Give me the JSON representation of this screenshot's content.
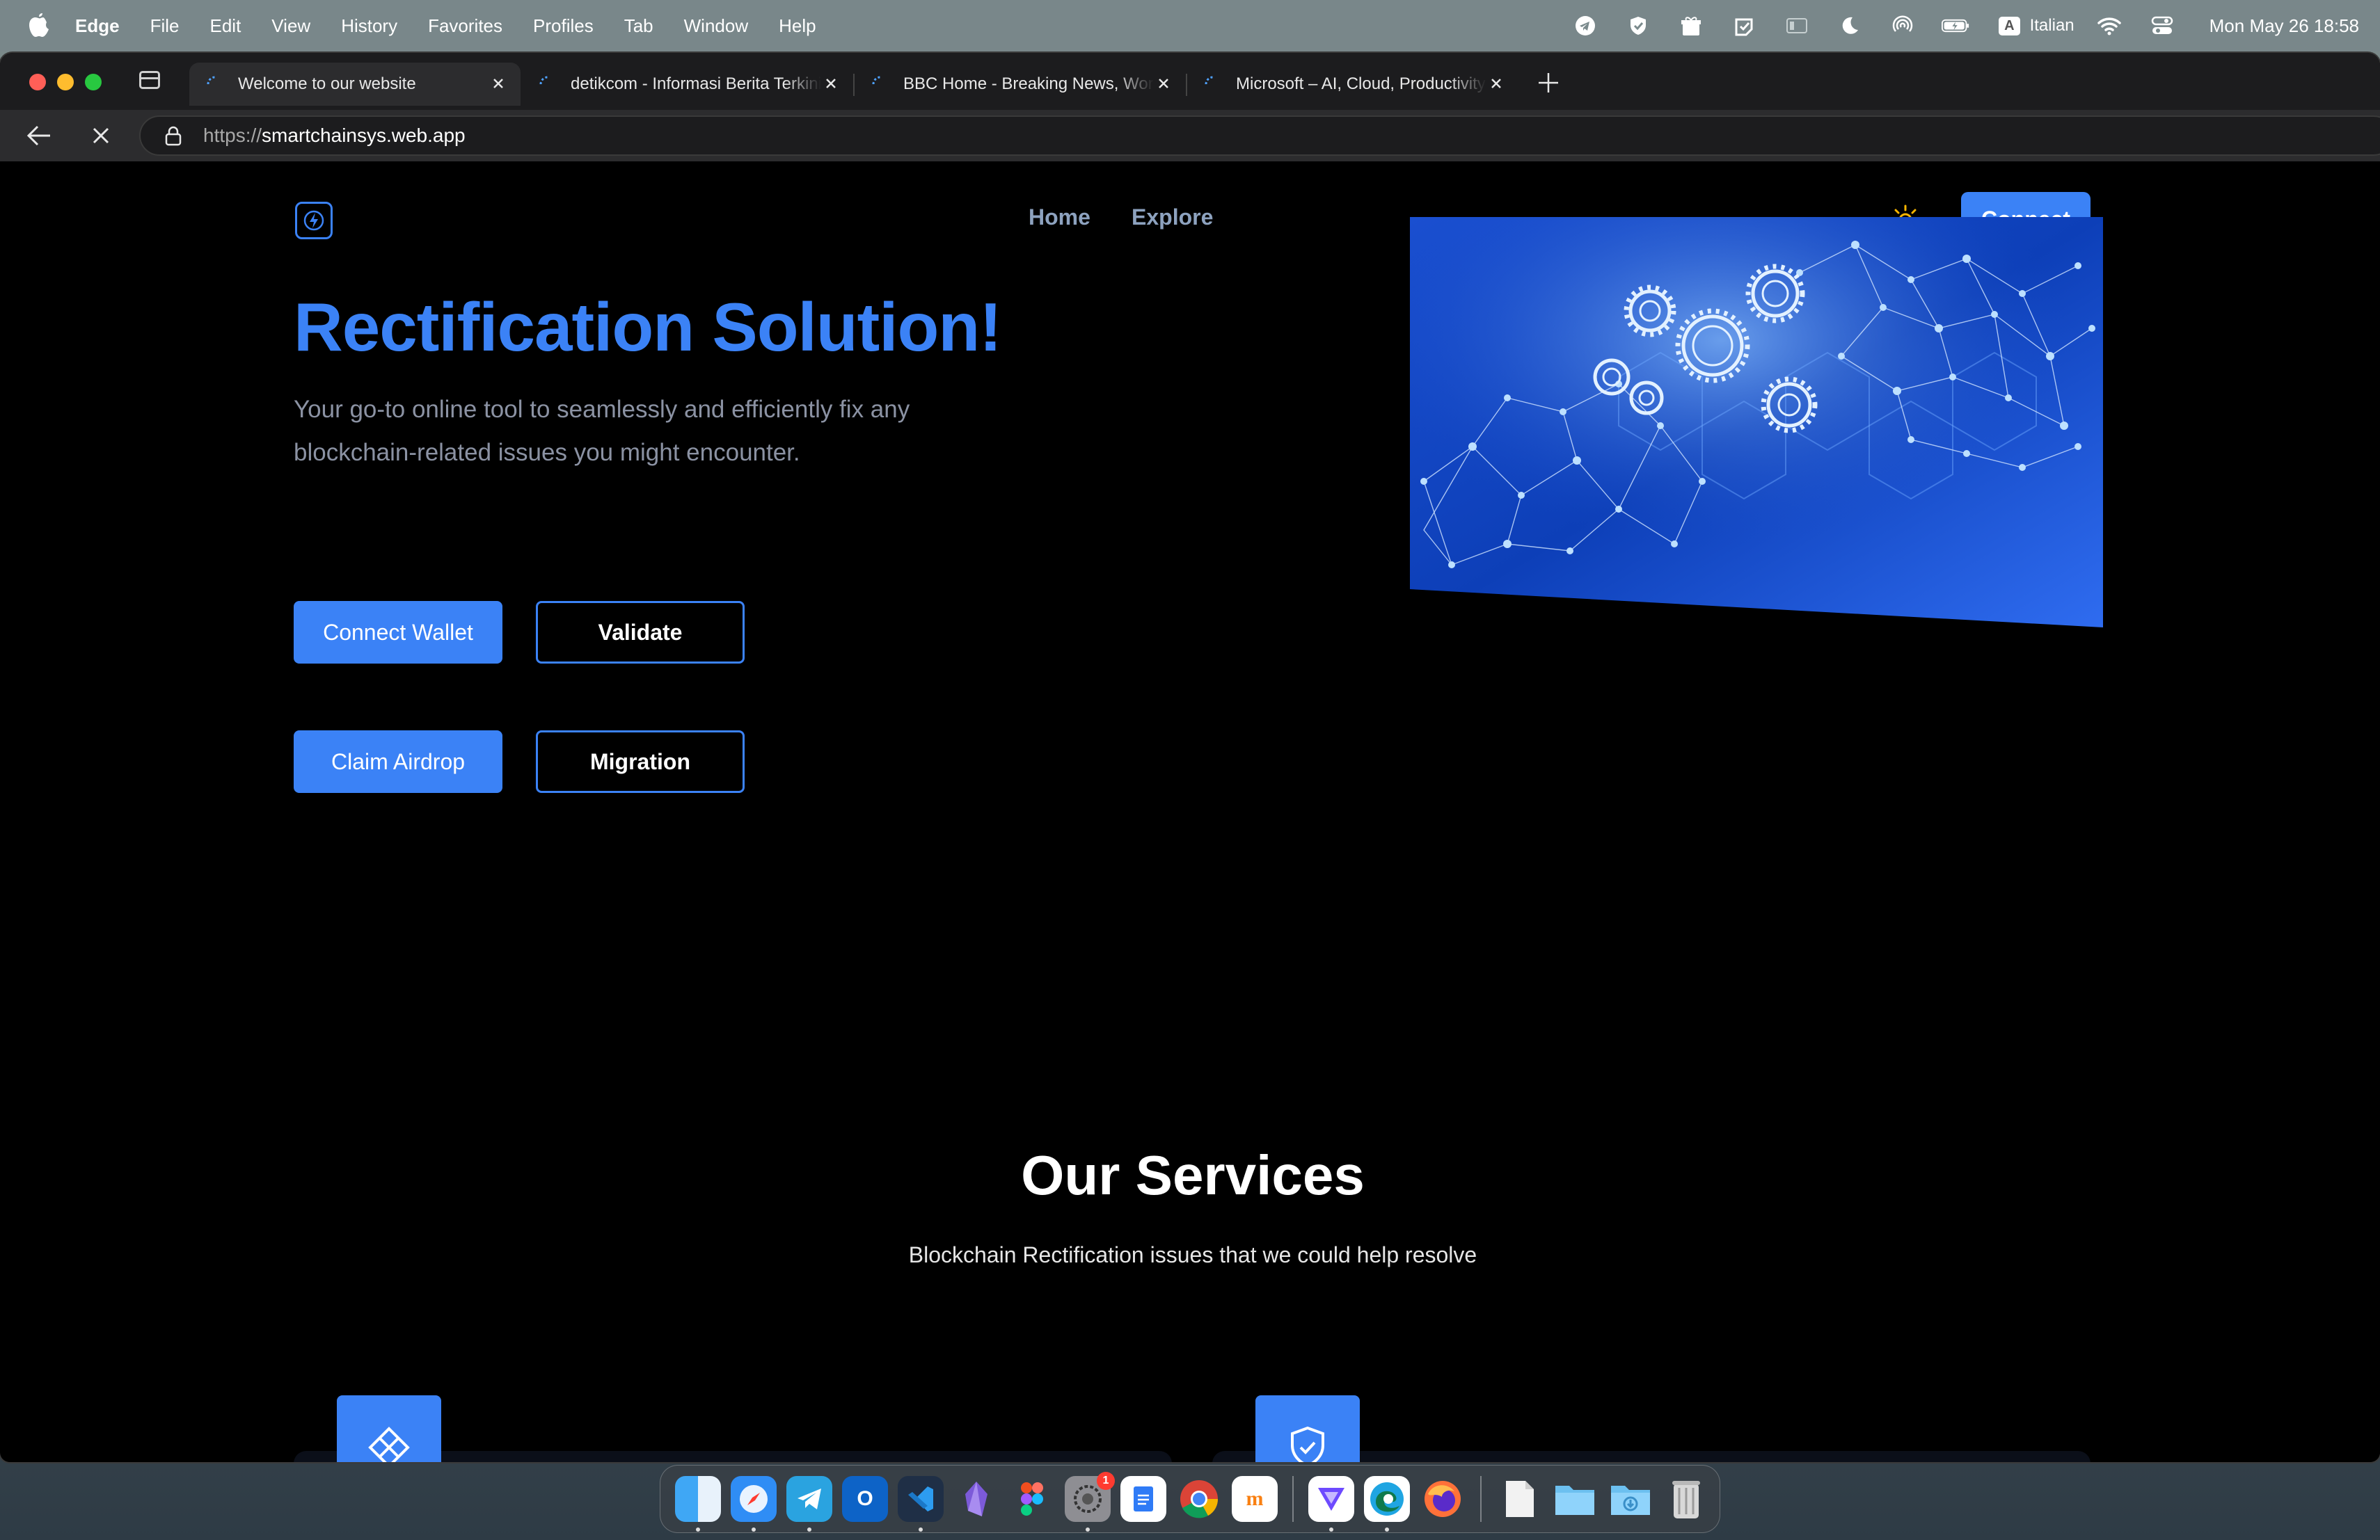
{
  "menubar": {
    "app_name": "Edge",
    "items": [
      "File",
      "Edit",
      "View",
      "History",
      "Favorites",
      "Profiles",
      "Tab",
      "Window",
      "Help"
    ],
    "language_badge": "A",
    "language": "Italian",
    "clock": "Mon May 26  18:58"
  },
  "tabs": [
    {
      "title": "Welcome to our website",
      "active": true
    },
    {
      "title": "detikcom - Informasi Berita Terkini",
      "active": false
    },
    {
      "title": "BBC Home - Breaking News, World News",
      "active": false
    },
    {
      "title": "Microsoft – AI, Cloud, Productivity",
      "active": false
    }
  ],
  "address": {
    "scheme": "https://",
    "host": "smartchainsys.web.app"
  },
  "site": {
    "nav": {
      "home": "Home",
      "explore": "Explore",
      "connect": "Connect"
    },
    "hero": {
      "title": "Rectification Solution!",
      "subtitle": "Your go-to online tool to seamlessly and efficiently fix any blockchain-related issues you might encounter.",
      "buttons": {
        "connect_wallet": "Connect Wallet",
        "validate": "Validate",
        "claim_airdrop": "Claim Airdrop",
        "migration": "Migration"
      }
    },
    "services": {
      "title": "Our Services",
      "subtitle": "Blockchain Rectification issues that we could help resolve"
    }
  },
  "dock": {
    "apps": [
      "finder-icon",
      "safari-icon",
      "telegram-icon",
      "outlook-icon",
      "vscode-icon",
      "obsidian-icon",
      "figma-icon",
      "system-settings-icon",
      "docs-icon",
      "chrome-icon",
      "moodle-icon",
      "proton-vpn-icon",
      "edge-icon",
      "firefox-icon",
      "documents-folder-icon",
      "folder-icon",
      "downloads-folder-icon",
      "trash-icon"
    ],
    "settings_badge": "1"
  },
  "colors": {
    "accent": "#3b82f6",
    "page_bg": "#000000",
    "nav_text": "#8da2bf"
  }
}
